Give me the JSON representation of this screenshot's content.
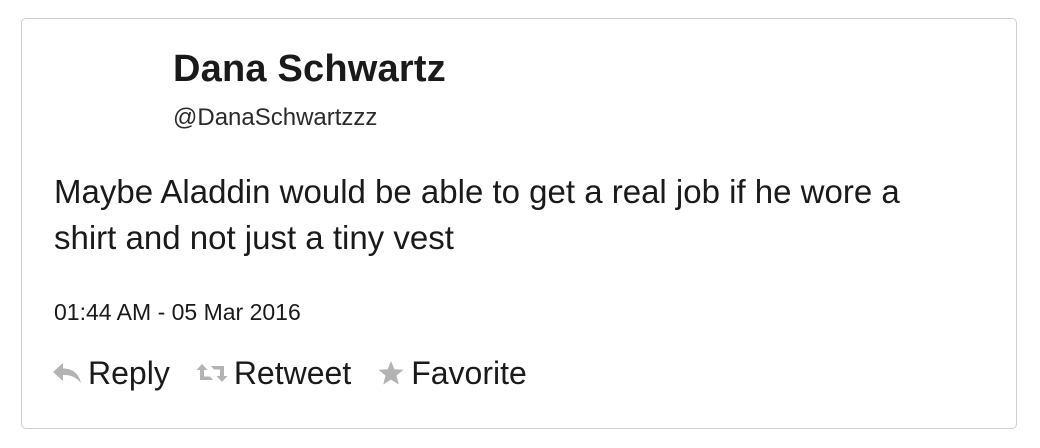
{
  "tweet": {
    "display_name": "Dana Schwartz",
    "handle": "@DanaSchwartzzz",
    "text": "Maybe Aladdin would be able to get a real job if he wore a shirt and not just a tiny vest",
    "timestamp": "01:44 AM - 05 Mar 2016"
  },
  "actions": {
    "reply": {
      "label": "Reply",
      "icon": "reply-icon"
    },
    "retweet": {
      "label": "Retweet",
      "icon": "retweet-icon"
    },
    "favorite": {
      "label": "Favorite",
      "icon": "star-icon"
    }
  },
  "colors": {
    "text": "#1a1a1a",
    "icon": "#b3b3b3",
    "border": "#cfcfcf",
    "background": "#ffffff"
  }
}
